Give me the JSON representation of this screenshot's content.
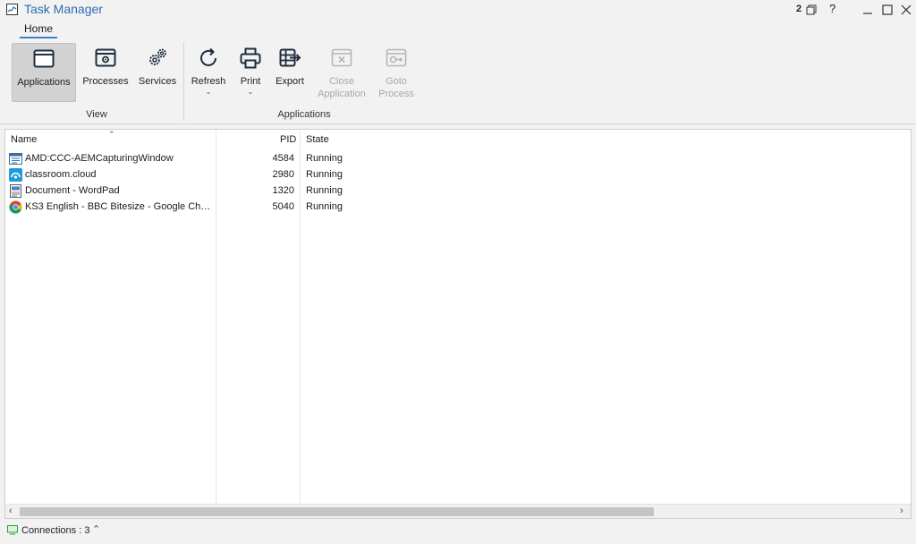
{
  "window": {
    "title": "Task Manager",
    "session_count": "2",
    "help_label": "?"
  },
  "ribbon": {
    "tab": "Home",
    "groups": {
      "view": "View",
      "applications": "Applications"
    },
    "buttons": {
      "applications": "Applications",
      "processes": "Processes",
      "services": "Services",
      "refresh": "Refresh",
      "print": "Print",
      "export": "Export",
      "close_app_line1": "Close",
      "close_app_line2": "Application",
      "goto_line1": "Goto",
      "goto_line2": "Process"
    }
  },
  "table": {
    "columns": {
      "name": "Name",
      "pid": "PID",
      "state": "State"
    },
    "rows": [
      {
        "name": "AMD:CCC-AEMCapturingWindow",
        "pid": "4584",
        "state": "Running",
        "icon": "window-app-icon"
      },
      {
        "name": "classroom.cloud",
        "pid": "2980",
        "state": "Running",
        "icon": "classroom-cloud-icon"
      },
      {
        "name": "Document - WordPad",
        "pid": "1320",
        "state": "Running",
        "icon": "wordpad-icon"
      },
      {
        "name": "KS3 English - BBC Bitesize - Google Chro...",
        "pid": "5040",
        "state": "Running",
        "icon": "chrome-icon"
      }
    ]
  },
  "status": {
    "connections": "Connections : 3"
  },
  "colors": {
    "title_blue": "#2b6cb0",
    "tab_underline": "#3b82c4",
    "selected_button": "#d2d2d2"
  }
}
